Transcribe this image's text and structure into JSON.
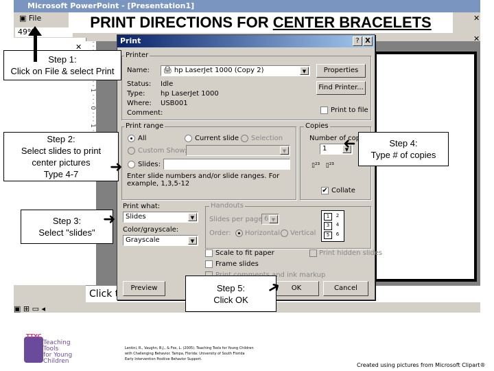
{
  "title": {
    "prefix": "PRINT DIRECTIONS FOR ",
    "underlined": "CENTER BRACELETS"
  },
  "app": {
    "window_title": "Microsoft PowerPoint - [Presentation1]",
    "menu_file": "File",
    "zoom": "49%",
    "notes_placeholder": "Click to"
  },
  "dialog": {
    "title": "Print",
    "help": "?",
    "close": "X",
    "printer": {
      "group": "Printer",
      "name_label": "Name:",
      "name_value": "hp LaserJet 1000 (Copy 2)",
      "status_label": "Status:",
      "status_value": "Idle",
      "type_label": "Type:",
      "type_value": "hp LaserJet 1000",
      "where_label": "Where:",
      "where_value": "USB001",
      "comment_label": "Comment:",
      "properties": "Properties",
      "find": "Find Printer...",
      "print_to_file": "Print to file"
    },
    "range": {
      "group": "Print range",
      "all": "All",
      "current": "Current slide",
      "selection": "Selection",
      "custom": "Custom Show:",
      "slides": "Slides:",
      "hint": "Enter slide numbers and/or slide ranges. For example, 1,3,5-12"
    },
    "copies": {
      "group": "Copies",
      "number_label": "Number of copies:",
      "number_value": "1",
      "collate": "Collate"
    },
    "print_what": {
      "label": "Print what:",
      "value": "Slides"
    },
    "color": {
      "label": "Color/grayscale:",
      "value": "Grayscale"
    },
    "handouts": {
      "group": "Handouts",
      "per_page_label": "Slides per page:",
      "per_page_value": "6",
      "order_label": "Order:",
      "horizontal": "Horizontal",
      "vertical": "Vertical",
      "thumbs": [
        "1",
        "2",
        "3",
        "4",
        "5",
        "6"
      ]
    },
    "options": {
      "scale": "Scale to fit paper",
      "frame": "Frame slides",
      "comments": "Print comments and ink markup",
      "hidden": "Print hidden slides"
    },
    "buttons": {
      "preview": "Preview",
      "ok": "OK",
      "cancel": "Cancel"
    }
  },
  "callouts": {
    "step1": [
      "Step 1:",
      "Click on File &  select Print"
    ],
    "step2": [
      "Step 2:",
      "Select slides to print",
      "center pictures",
      "Type 4-7"
    ],
    "step3": [
      "Step 3:",
      "Select \"slides\""
    ],
    "step4": [
      "Step 4:",
      "Type # of copies"
    ],
    "step5": [
      "Step 5:",
      "Click OK"
    ]
  },
  "footer": {
    "logo": "TTYC Teaching Tools for Young Children with Challenging Behavior",
    "citation": [
      "Lentini, R., Vaughn, B.J., & Fox, L. (2005). Teaching Tools for Young Children",
      "with Challenging Behavior. Tampa, Florida: University of South Florida",
      "Early Intervention Positive Behavior Support."
    ],
    "credit": "Created using pictures from Microsoft Clipart®"
  }
}
